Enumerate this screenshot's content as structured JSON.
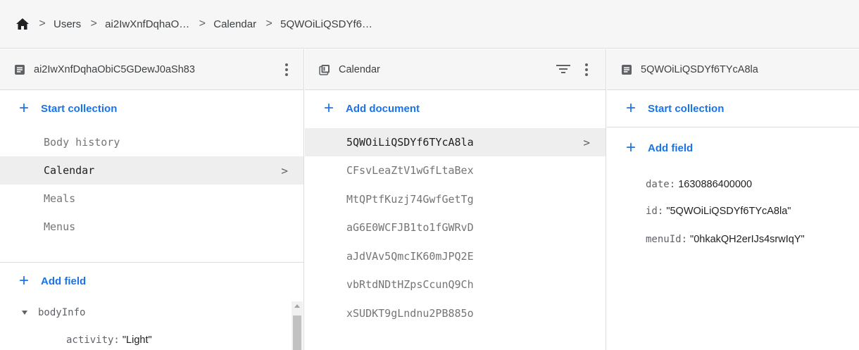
{
  "breadcrumb": {
    "items": [
      "Users",
      "ai2IwXnfDqhaO…",
      "Calendar",
      "5QWOiLiQSDYf6…"
    ],
    "separator": ">"
  },
  "panel1": {
    "title": "ai2IwXnfDqhaObiC5GDewJ0aSh83",
    "start_collection": "Start collection",
    "collections": [
      "Body history",
      "Calendar",
      "Meals",
      "Menus"
    ],
    "selected": "Calendar",
    "add_field": "Add field",
    "fields": {
      "bodyInfo_key": "bodyInfo",
      "activity_key": "activity:",
      "activity_val": "\"Light\""
    }
  },
  "panel2": {
    "title": "Calendar",
    "add_document": "Add document",
    "documents": [
      "5QWOiLiQSDYf6TYcA8la",
      "CFsvLeaZtV1wGfLtaBex",
      "MtQPtfKuzj74GwfGetTg",
      "aG6E0WCFJB1to1fGWRvD",
      "aJdVAv5QmcIK60mJPQ2E",
      "vbRtdNDtHZpsCcunQ9Ch",
      "xSUDKT9gLndnu2PB885o"
    ],
    "selected": "5QWOiLiQSDYf6TYcA8la"
  },
  "panel3": {
    "title": "5QWOiLiQSDYf6TYcA8la",
    "start_collection": "Start collection",
    "add_field": "Add field",
    "fields": [
      {
        "key": "date:",
        "value": "1630886400000"
      },
      {
        "key": "id:",
        "value": "\"5QWOiLiQSDYf6TYcA8la\""
      },
      {
        "key": "menuId:",
        "value": "\"0hkakQH2erIJs4srwIqY\""
      }
    ]
  },
  "colors": {
    "accent": "#1a73e8",
    "header_bg": "#f6f6f6",
    "selected_bg": "#eeeeee"
  },
  "icons": [
    "home-icon",
    "chevron-right-icon",
    "document-icon",
    "collection-icon",
    "filter-icon",
    "more-vert-icon",
    "plus-icon",
    "caret-down-icon"
  ]
}
